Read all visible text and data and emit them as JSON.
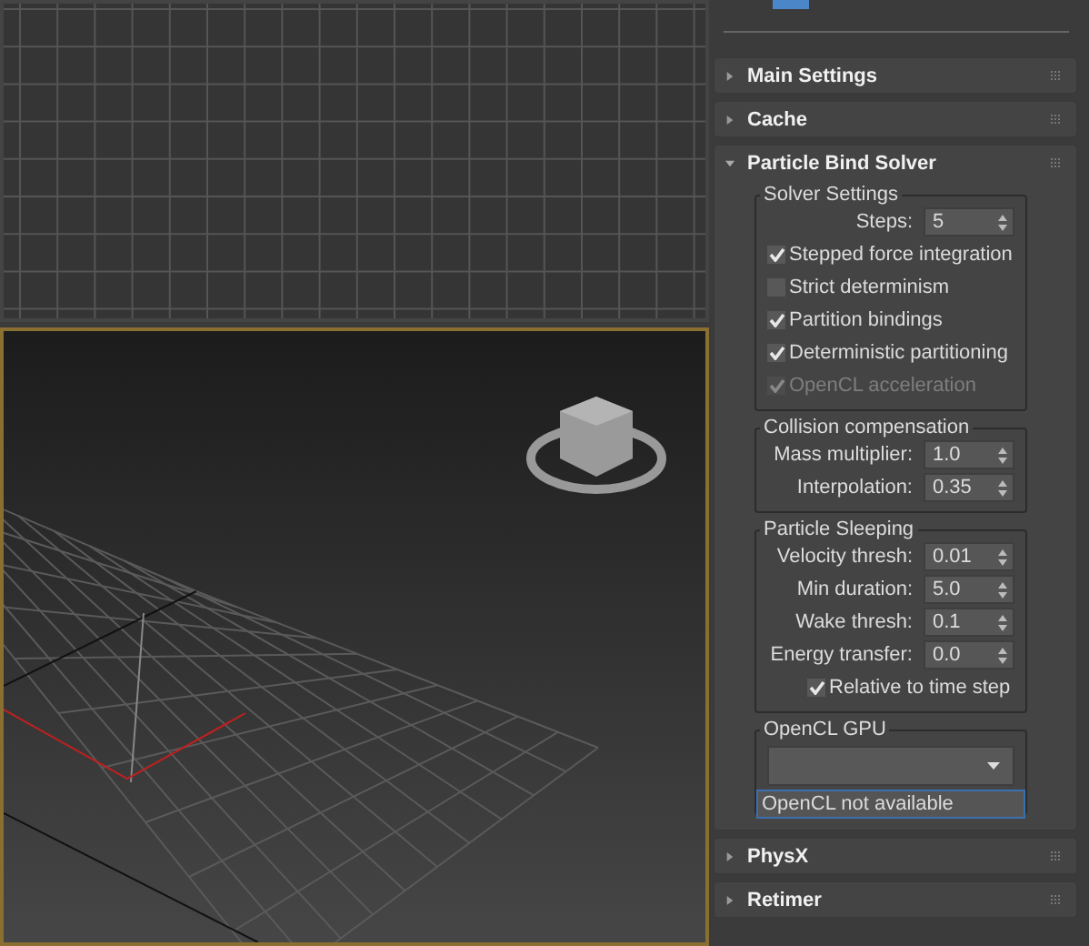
{
  "viewports": [
    {
      "kind": "top",
      "active": false
    },
    {
      "kind": "perspective",
      "active": true
    }
  ],
  "rollouts": [
    {
      "title": "Main Settings",
      "expanded": false
    },
    {
      "title": "Cache",
      "expanded": false
    },
    {
      "title": "Particle Bind Solver",
      "expanded": true,
      "groups": [
        {
          "title": "Solver Settings",
          "items": [
            {
              "kind": "spinner",
              "label": "Steps:",
              "value": "5"
            },
            {
              "kind": "checkbox",
              "label": "Stepped force integration",
              "checked": true,
              "disabled": false
            },
            {
              "kind": "checkbox",
              "label": "Strict determinism",
              "checked": false,
              "disabled": false
            },
            {
              "kind": "checkbox",
              "label": "Partition bindings",
              "checked": true,
              "disabled": false
            },
            {
              "kind": "checkbox",
              "label": "Deterministic partitioning",
              "checked": true,
              "disabled": false
            },
            {
              "kind": "checkbox",
              "label": "OpenCL acceleration",
              "checked": true,
              "disabled": true
            }
          ]
        },
        {
          "title": "Collision compensation",
          "items": [
            {
              "kind": "spinner",
              "label": "Mass multiplier:",
              "value": "1.0"
            },
            {
              "kind": "spinner",
              "label": "Interpolation:",
              "value": "0.35"
            }
          ]
        },
        {
          "title": "Particle Sleeping",
          "items": [
            {
              "kind": "spinner",
              "label": "Velocity thresh:",
              "value": "0.01"
            },
            {
              "kind": "spinner",
              "label": "Min duration:",
              "value": "5.0"
            },
            {
              "kind": "spinner",
              "label": "Wake thresh:",
              "value": "0.1"
            },
            {
              "kind": "spinner",
              "label": "Energy transfer:",
              "value": "0.0"
            },
            {
              "kind": "checkbox",
              "label": "Relative to time step",
              "checked": true,
              "disabled": false,
              "indented": true
            }
          ]
        },
        {
          "title": "OpenCL GPU",
          "items": [
            {
              "kind": "dropdown"
            },
            {
              "kind": "status",
              "label": "OpenCL not available"
            }
          ]
        }
      ]
    },
    {
      "title": "PhysX",
      "expanded": false
    },
    {
      "title": "Retimer",
      "expanded": false
    }
  ]
}
